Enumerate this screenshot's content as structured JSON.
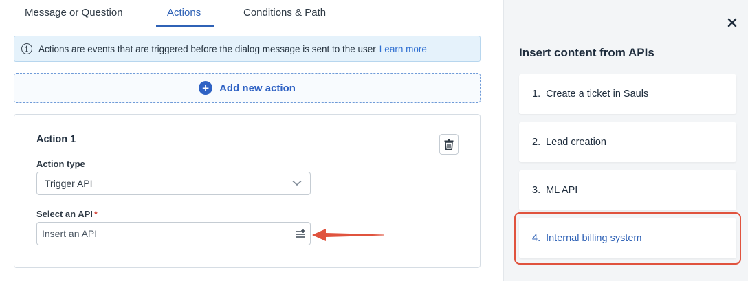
{
  "tabs": [
    {
      "label": "Message or Question"
    },
    {
      "label": "Actions",
      "active": true
    },
    {
      "label": "Conditions & Path"
    }
  ],
  "info": {
    "text": "Actions are events that are triggered before the dialog message is sent to the user",
    "link": "Learn more",
    "icon": "info-icon"
  },
  "add_action": {
    "label": "Add new action",
    "icon": "plus-circle-icon"
  },
  "action_card": {
    "title": "Action 1",
    "action_type": {
      "label": "Action type",
      "value": "Trigger API"
    },
    "select_api": {
      "label": "Select an API",
      "required_mark": "*",
      "placeholder": "Insert an API"
    }
  },
  "panel": {
    "title": "Insert content from APIs",
    "items": [
      {
        "num": "1.",
        "label": "Create a ticket in Sauls"
      },
      {
        "num": "2.",
        "label": "Lead creation"
      },
      {
        "num": "3.",
        "label": "ML API"
      },
      {
        "num": "4.",
        "label": "Internal billing system",
        "highlighted": true
      }
    ]
  },
  "colors": {
    "accent": "#2f62b6",
    "annotation": "#e0533e",
    "info_bg": "#e5f2fb",
    "panel_bg": "#f3f5f7"
  }
}
